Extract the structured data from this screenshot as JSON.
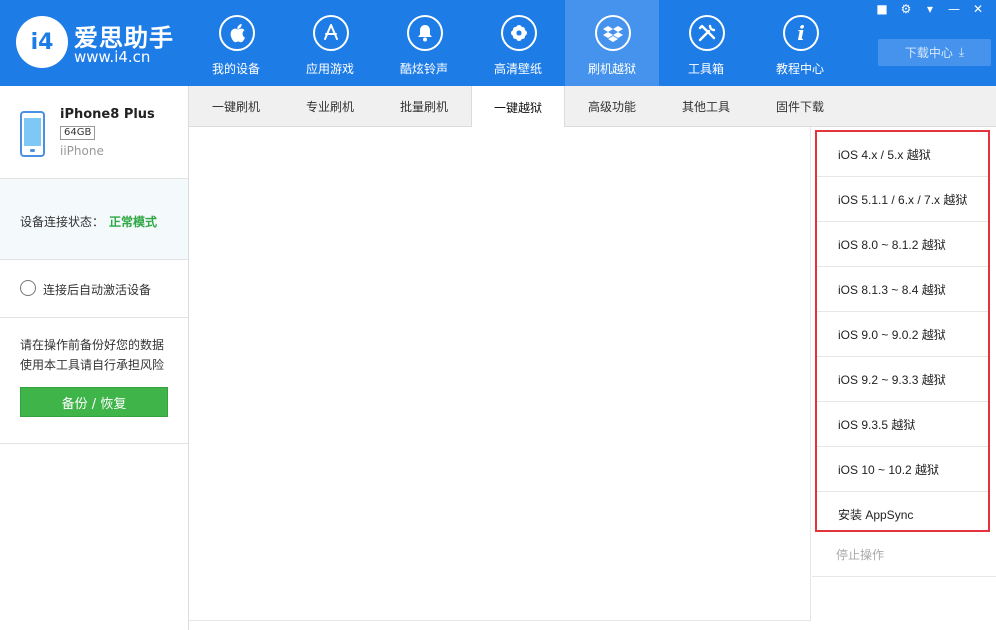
{
  "header": {
    "logo_text": "i4",
    "brand": "爱思助手",
    "url": "www.i4.cn",
    "nav": [
      {
        "label": "我的设备",
        "icon": "apple-icon"
      },
      {
        "label": "应用游戏",
        "icon": "app-store-icon"
      },
      {
        "label": "酷炫铃声",
        "icon": "bell-icon"
      },
      {
        "label": "高清壁纸",
        "icon": "flower-icon"
      },
      {
        "label": "刷机越狱",
        "icon": "dropbox-icon"
      },
      {
        "label": "工具箱",
        "icon": "tools-icon"
      },
      {
        "label": "教程中心",
        "icon": "info-icon"
      }
    ],
    "download_label": "下载中心"
  },
  "device": {
    "name": "iPhone8 Plus",
    "capacity": "64GB",
    "sub": "iiPhone"
  },
  "connection": {
    "label": "设备连接状态：",
    "status": "正常模式"
  },
  "auto_activate": {
    "label": "连接后自动激活设备"
  },
  "warning": {
    "line1": "请在操作前备份好您的数据",
    "line2": "使用本工具请自行承担风险",
    "button": "备份 / 恢复"
  },
  "tabs": [
    {
      "label": "一键刷机"
    },
    {
      "label": "专业刷机"
    },
    {
      "label": "批量刷机"
    },
    {
      "label": "一键越狱"
    },
    {
      "label": "高级功能"
    },
    {
      "label": "其他工具"
    },
    {
      "label": "固件下载"
    }
  ],
  "jailbreak_options": [
    {
      "label": "iOS 4.x / 5.x 越狱"
    },
    {
      "label": "iOS 5.1.1 / 6.x / 7.x 越狱"
    },
    {
      "label": "iOS 8.0 ~ 8.1.2 越狱"
    },
    {
      "label": "iOS 8.1.3 ~ 8.4 越狱"
    },
    {
      "label": "iOS 9.0 ~ 9.0.2 越狱"
    },
    {
      "label": "iOS 9.2 ~ 9.3.3 越狱"
    },
    {
      "label": "iOS 9.3.5 越狱"
    },
    {
      "label": "iOS 10 ~ 10.2 越狱"
    },
    {
      "label": "安装 AppSync"
    }
  ],
  "stop_label": "停止操作",
  "colors": {
    "header_bg": "#1e7ce6",
    "active_nav": "#4593ec",
    "status_green": "#2ea844",
    "button_green": "#3fb449",
    "highlight_red": "#e3343b"
  }
}
